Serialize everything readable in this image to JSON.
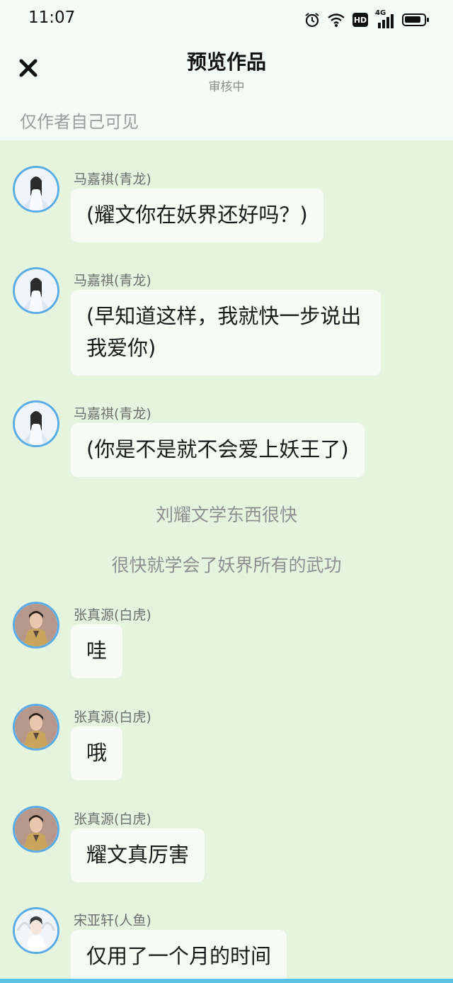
{
  "status_bar": {
    "time": "11:07",
    "icons": [
      "alarm-icon",
      "wifi-icon",
      "hd-icon",
      "signal-4g-icon",
      "battery-icon"
    ],
    "hd_label": "HD",
    "network_label": "4G"
  },
  "header": {
    "title": "预览作品",
    "subtitle": "审核中",
    "visibility_note": "仅作者自己可见"
  },
  "colors": {
    "page_bg": "#f3fbf6",
    "chat_bg": "#e5f4dd",
    "bubble_bg": "#f6fbf4",
    "avatar_ring": "#5aace6",
    "bottom_strip": "#5cc3e5"
  },
  "messages": [
    {
      "type": "chat",
      "speaker": "马嘉祺(青龙)",
      "avatar": "qinglong",
      "text": "(耀文你在妖界还好吗？)"
    },
    {
      "type": "chat",
      "speaker": "马嘉祺(青龙)",
      "avatar": "qinglong",
      "text": "(早知道这样，我就快一步说出我爱你)"
    },
    {
      "type": "chat",
      "speaker": "马嘉祺(青龙)",
      "avatar": "qinglong",
      "text": "(你是不是就不会爱上妖王了)"
    },
    {
      "type": "narration",
      "text": "刘耀文学东西很快"
    },
    {
      "type": "narration",
      "text": "很快就学会了妖界所有的武功"
    },
    {
      "type": "chat",
      "speaker": "张真源(白虎)",
      "avatar": "baihu",
      "text": "哇"
    },
    {
      "type": "chat",
      "speaker": "张真源(白虎)",
      "avatar": "baihu",
      "text": "哦"
    },
    {
      "type": "chat",
      "speaker": "张真源(白虎)",
      "avatar": "baihu",
      "text": "耀文真厉害"
    },
    {
      "type": "chat",
      "speaker": "宋亚轩(人鱼)",
      "avatar": "renyu",
      "text": "仅用了一个月的时间"
    }
  ]
}
